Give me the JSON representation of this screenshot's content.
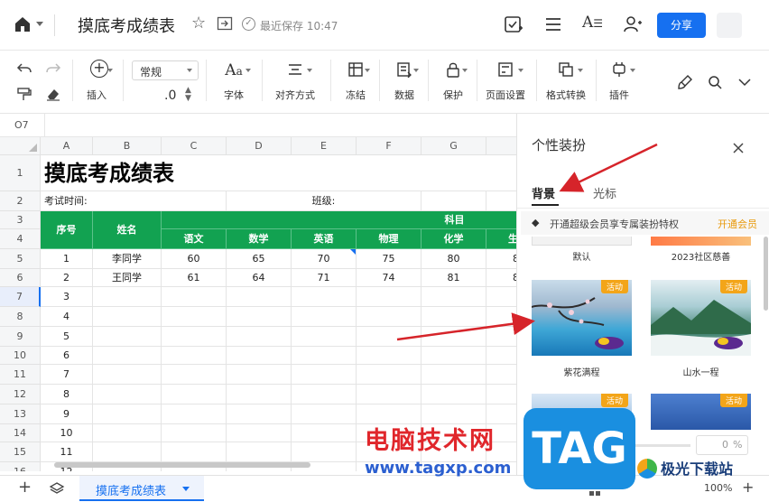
{
  "header": {
    "title": "摸底考成绩表",
    "save_status": "最近保存 10:47",
    "share_label": "分享"
  },
  "toolbar": {
    "insert": "插入",
    "number_format": "常规",
    "decimal": ".0",
    "font": "字体",
    "align": "对齐方式",
    "freeze": "冻结",
    "data": "数据",
    "protect": "保护",
    "page_setup": "页面设置",
    "format_convert": "格式转换",
    "plugin": "插件"
  },
  "cell_ref": "O7",
  "sheet": {
    "columns": [
      "A",
      "B",
      "C",
      "D",
      "E",
      "F",
      "G"
    ],
    "rows": [
      "1",
      "2",
      "3",
      "4",
      "5",
      "6",
      "7",
      "8",
      "9",
      "10",
      "11",
      "12",
      "13",
      "14",
      "15",
      "16"
    ],
    "title": "摸底考成绩表",
    "exam_time": "考试时间:",
    "class_label": "班级:",
    "col_seq": "序号",
    "col_name": "姓名",
    "col_subject": "科目",
    "subjects": [
      "语文",
      "数学",
      "英语",
      "物理",
      "化学",
      "生"
    ],
    "records": [
      {
        "seq": "1",
        "name": "李同学",
        "scores": [
          "60",
          "65",
          "70",
          "75",
          "80",
          "8"
        ]
      },
      {
        "seq": "2",
        "name": "王同学",
        "scores": [
          "61",
          "64",
          "71",
          "74",
          "81",
          "8"
        ]
      }
    ],
    "seq_more": [
      "3",
      "4",
      "5",
      "6",
      "7",
      "8",
      "9",
      "10",
      "11",
      "12"
    ]
  },
  "panel": {
    "title": "个性装扮",
    "tabs": [
      "背景",
      "光标"
    ],
    "vip_text": "开通超级会员享专属装扮特权",
    "vip_link": "开通会员",
    "themes": [
      {
        "label": "默认",
        "badge": ""
      },
      {
        "label": "2023社区慈善",
        "badge": ""
      },
      {
        "label": "紫花满程",
        "badge": "活动"
      },
      {
        "label": "山水一程",
        "badge": "活动"
      },
      {
        "label": "",
        "badge": "活动"
      },
      {
        "label": "",
        "badge": "活动"
      }
    ],
    "opacity_value": "0",
    "opacity_unit": "%"
  },
  "bottombar": {
    "sheet_tab": "摸底考成绩表",
    "zoom": "100%"
  },
  "watermark": {
    "site_cn": "电脑技术网",
    "site_url": "www.tagxp.com",
    "logo": "TAG",
    "brand": "极光下载站"
  },
  "colors": {
    "accent": "#1670f0",
    "header_green": "#12a251",
    "active_tag": "#f3a519",
    "vip": "#e89a0c"
  }
}
